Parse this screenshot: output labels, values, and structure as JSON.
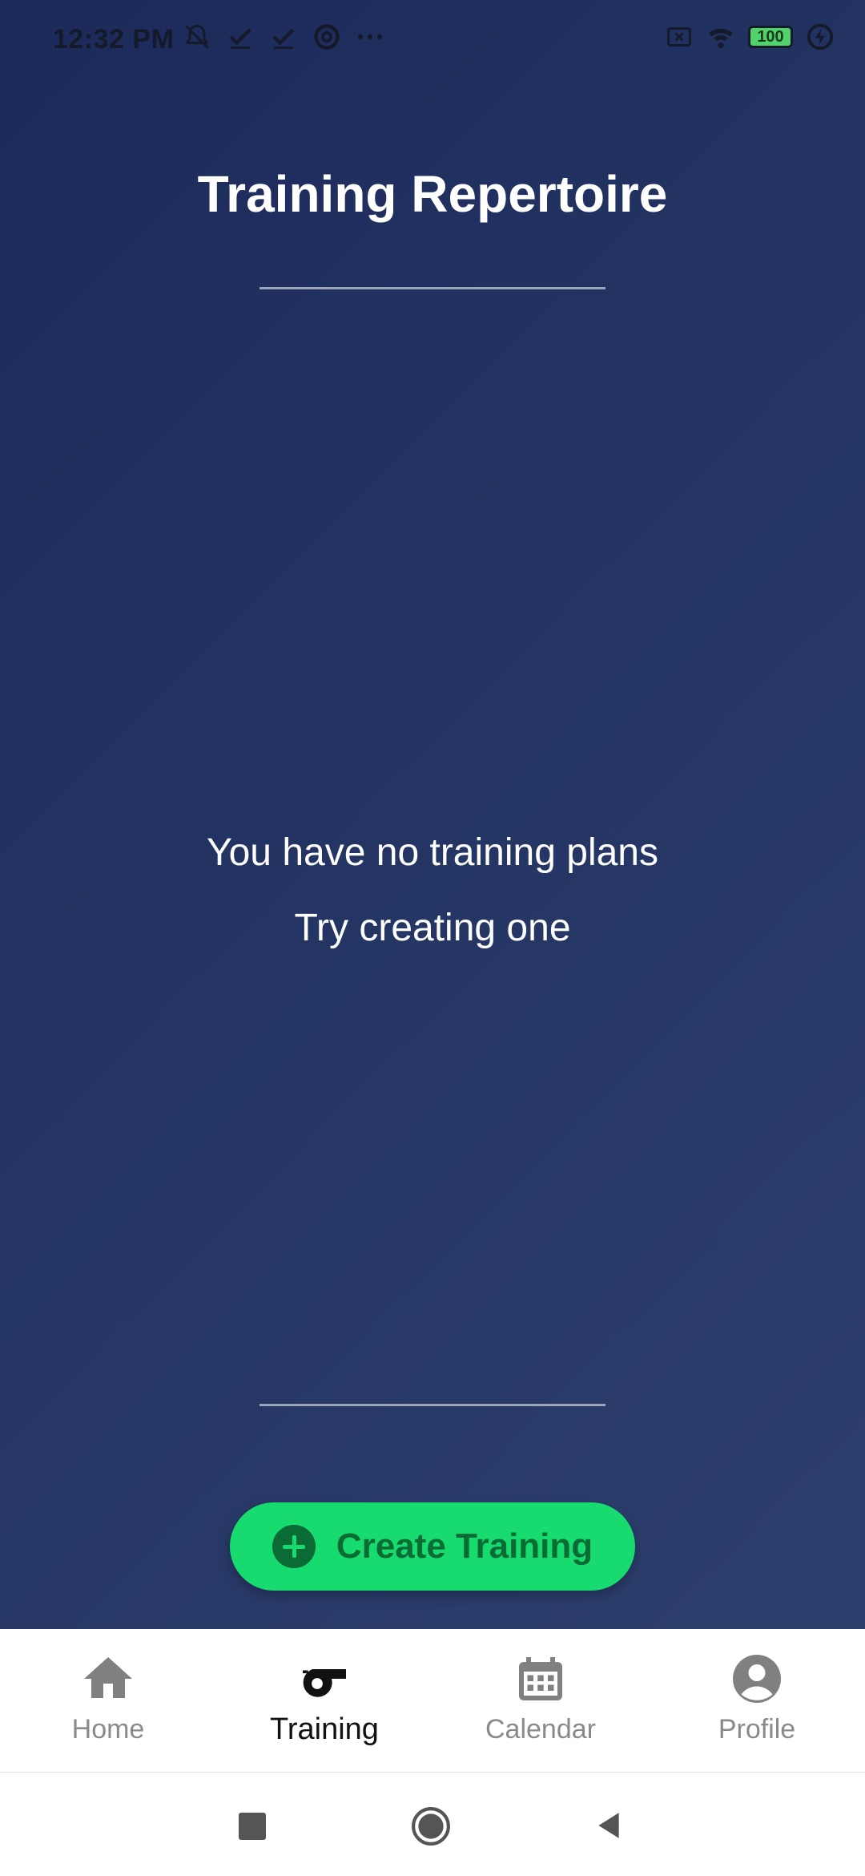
{
  "status_bar": {
    "time": "12:32 PM",
    "battery": "100",
    "left_icons": [
      "muted-bell-icon",
      "check-icon",
      "check-icon",
      "at-sign-icon",
      "more-icon"
    ],
    "right_icons": [
      "sim-off-icon",
      "wifi-icon",
      "battery-icon",
      "charging-icon"
    ]
  },
  "page": {
    "title": "Training Repertoire",
    "empty_line_1": "You have no training plans",
    "empty_line_2": "Try creating one"
  },
  "create_button": {
    "label": "Create Training",
    "color": "#17db6f"
  },
  "bottom_nav": {
    "items": [
      {
        "label": "Home",
        "icon": "home-icon"
      },
      {
        "label": "Training",
        "icon": "whistle-icon",
        "active": true
      },
      {
        "label": "Calendar",
        "icon": "calendar-icon"
      },
      {
        "label": "Profile",
        "icon": "profile-icon"
      }
    ]
  },
  "system_nav": {
    "buttons": [
      "recent-apps-button",
      "home-button",
      "back-button"
    ]
  },
  "colors": {
    "background": "#233463",
    "accent": "#17db6f"
  }
}
